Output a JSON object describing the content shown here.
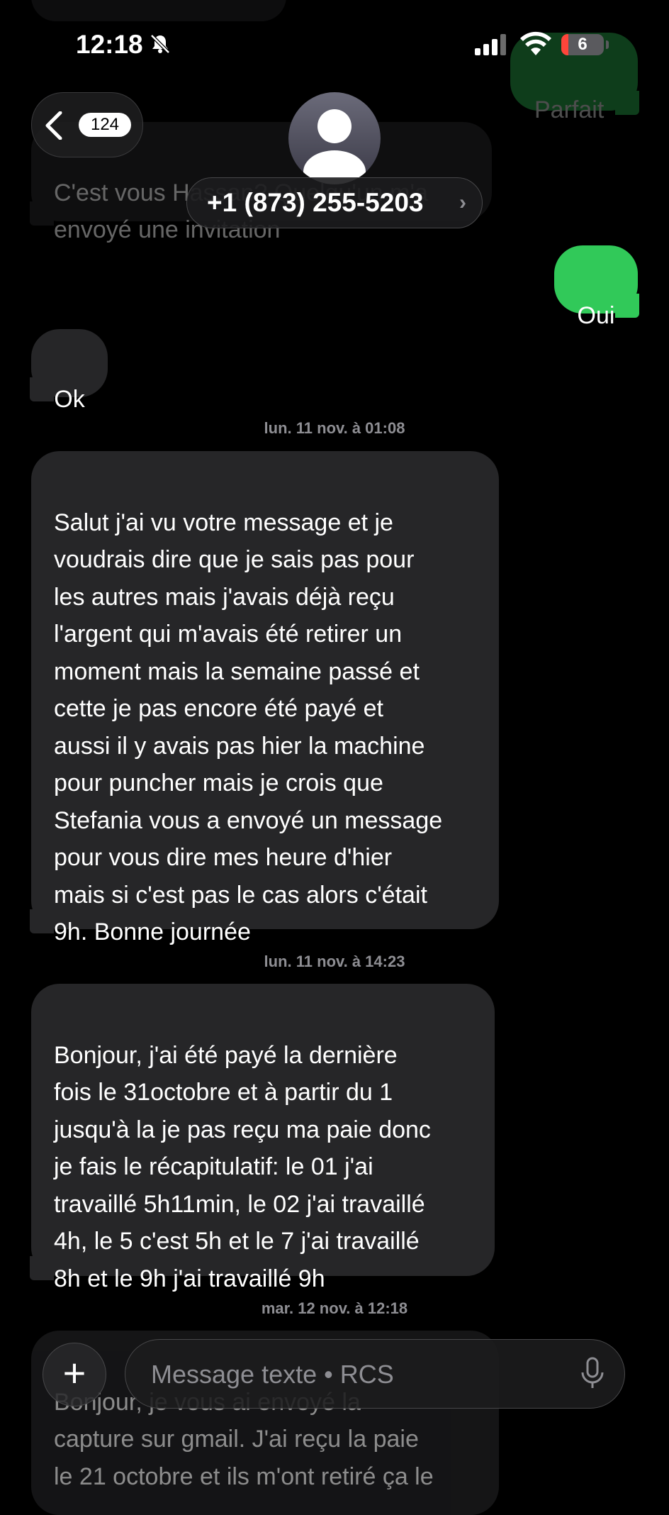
{
  "status_bar": {
    "time": "12:18",
    "battery": "6"
  },
  "nav": {
    "unread_count": "124",
    "contact": "+1 (873) 255-5203",
    "chevron": "›"
  },
  "messages": [
    {
      "dir": "out",
      "text": "Parfait"
    },
    {
      "dir": "in",
      "text": "C'est vous Hassan? Quelqu'un m'a\nenvoyé une invitation"
    },
    {
      "dir": "out",
      "text": "Oui"
    },
    {
      "dir": "in",
      "text": "Ok"
    },
    {
      "dir": "in",
      "text": "Salut j'ai vu votre message et je\nvoudrais dire que je sais pas pour\nles autres mais j'avais déjà reçu\nl'argent qui m'avais été  retirer un\nmoment mais la semaine passé et\ncette je pas encore été payé et\naussi il y avais pas hier la machine\npour puncher mais je crois que\nStefania vous a envoyé un message\npour vous dire mes heure d'hier\nmais si c'est pas le cas alors c'était\n9h. Bonne journée"
    },
    {
      "dir": "in",
      "text": "Bonjour, j'ai été payé la dernière\nfois le 31octobre et à partir du 1\njusqu'à la je pas reçu ma paie donc\nje fais le récapitulatif: le 01 j'ai\ntravaillé 5h11min, le 02 j'ai travaillé\n4h, le 5 c'est 5h et le 7 j'ai travaillé\n8h et le 9h j'ai travaillé 9h"
    },
    {
      "dir": "in",
      "text": "Bonjour, je vous ai envoyé la\ncapture sur gmail. J'ai reçu la paie\nle 21 octobre et ils m'ont retiré ça le"
    }
  ],
  "timestamps": [
    "lun. 11 nov. à 01:08",
    "lun. 11 nov. à 14:23",
    "mar. 12 nov. à 12:18"
  ],
  "composer": {
    "placeholder": "Message texte • RCS",
    "plus": "+"
  },
  "colors": {
    "incoming": "#262628",
    "outgoing": "#31c959",
    "background": "#000000"
  },
  "icons": [
    "bell-slash-icon",
    "cellular-signal-icon",
    "wifi-icon",
    "battery-icon",
    "back-chevron-icon",
    "contact-avatar-icon",
    "plus-icon",
    "microphone-icon"
  ]
}
